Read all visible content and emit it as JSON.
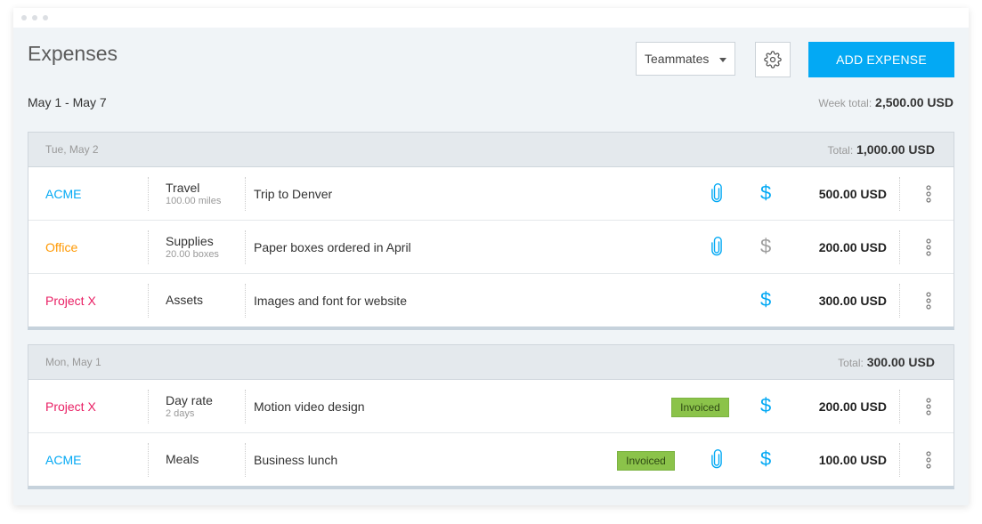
{
  "header": {
    "title": "Expenses",
    "teammates_label": "Teammates",
    "add_button": "ADD EXPENSE"
  },
  "period": {
    "range": "May 1 - May 7",
    "week_total_label": "Week total:",
    "week_total_value": "2,500.00 USD"
  },
  "colors": {
    "accent": "#03a9f4",
    "badge": "#8bc34a",
    "dollar_active": "#03a9f4",
    "dollar_inactive": "#9e9e9e"
  },
  "groups": [
    {
      "date": "Tue, May 2",
      "total_label": "Total:",
      "total_value": "1,000.00 USD",
      "rows": [
        {
          "project": "ACME",
          "project_color": "#03a9f4",
          "category": "Travel",
          "sub": "100.00 miles",
          "description": "Trip to Denver",
          "invoiced": "",
          "attachment": true,
          "billable": true,
          "amount": "500.00 USD"
        },
        {
          "project": "Office",
          "project_color": "#ff9800",
          "category": "Supplies",
          "sub": "20.00 boxes",
          "description": "Paper boxes ordered in April",
          "invoiced": "",
          "attachment": true,
          "billable": false,
          "amount": "200.00 USD"
        },
        {
          "project": "Project X",
          "project_color": "#e91e63",
          "category": "Assets",
          "sub": "",
          "description": "Images and font for website",
          "invoiced": "",
          "attachment": false,
          "billable": true,
          "amount": "300.00 USD"
        }
      ]
    },
    {
      "date": "Mon, May 1",
      "total_label": "Total:",
      "total_value": "300.00 USD",
      "rows": [
        {
          "project": "Project X",
          "project_color": "#e91e63",
          "category": "Day rate",
          "sub": "2 days",
          "description": "Motion video design",
          "invoiced": "Invoiced",
          "attachment": false,
          "billable": true,
          "amount": "200.00 USD"
        },
        {
          "project": "ACME",
          "project_color": "#03a9f4",
          "category": "Meals",
          "sub": "",
          "description": "Business lunch",
          "invoiced": "Invoiced",
          "attachment": true,
          "billable": true,
          "amount": "100.00 USD"
        }
      ]
    }
  ]
}
